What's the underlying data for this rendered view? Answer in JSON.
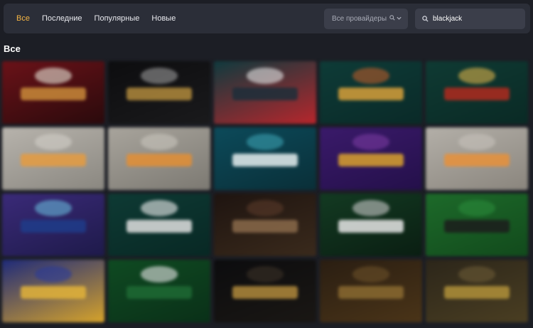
{
  "nav": {
    "tabs": [
      {
        "label": "Все",
        "active": true
      },
      {
        "label": "Последние",
        "active": false
      },
      {
        "label": "Популярные",
        "active": false
      },
      {
        "label": "Новые",
        "active": false
      }
    ]
  },
  "filters": {
    "provider_label": "Все провайдеры",
    "search_value": "blackjack",
    "icons": [
      "search-icon",
      "chevron-down-icon"
    ]
  },
  "section": {
    "title": "Все"
  },
  "colors": {
    "accent": "#f5b544",
    "background": "#1c1e25",
    "panel": "#2b2e38"
  },
  "games": [
    {
      "bg": "#6a1218",
      "bg2": "#2a0a0c",
      "logo": "#c98a3a",
      "deco": "#e8e2d6"
    },
    {
      "bg": "#0d0d0f",
      "bg2": "#1a1a1c",
      "logo": "#b08a3c",
      "deco": "#9a9a9a"
    },
    {
      "bg": "#0f3a3e",
      "bg2": "#b7262c",
      "logo": "#1c2e3a",
      "deco": "#e6e6e6"
    },
    {
      "bg": "#0e3b37",
      "bg2": "#0a2a28",
      "logo": "#d7a03a",
      "deco": "#b95c2a"
    },
    {
      "bg": "#0f3a33",
      "bg2": "#0a2a25",
      "logo": "#b02a1e",
      "deco": "#d8b04a"
    },
    {
      "bg": "#b7b3ac",
      "bg2": "#8a8780",
      "logo": "#e59b3f",
      "deco": "#d2cfc8"
    },
    {
      "bg": "#a8a49c",
      "bg2": "#7c7972",
      "logo": "#e38e34",
      "deco": "#c8c4bc"
    },
    {
      "bg": "#0c4a5a",
      "bg2": "#0a2f38",
      "logo": "#e6eef0",
      "deco": "#3aa0b0"
    },
    {
      "bg": "#3a1a6a",
      "bg2": "#24104a",
      "logo": "#d9a12e",
      "deco": "#7a3aa0"
    },
    {
      "bg": "#b3afa8",
      "bg2": "#8a857d",
      "logo": "#e8903a",
      "deco": "#c7c2ba"
    },
    {
      "bg": "#3a2a78",
      "bg2": "#1e1a4a",
      "logo": "#1e3c8a",
      "deco": "#68b8d8"
    },
    {
      "bg": "#0e3a34",
      "bg2": "#082824",
      "logo": "#e0e0e0",
      "deco": "#f0f0f0"
    },
    {
      "bg": "#1e1410",
      "bg2": "#3a2a1c",
      "logo": "#8a6a4a",
      "deco": "#5a3a2a"
    },
    {
      "bg": "#133a22",
      "bg2": "#0a1e12",
      "logo": "#e6e6e6",
      "deco": "#c8c8c8"
    },
    {
      "bg": "#1d6a2a",
      "bg2": "#124a1c",
      "logo": "#1c1c1c",
      "deco": "#2a8a3a"
    },
    {
      "bg": "#1e2a7a",
      "bg2": "#d6a32a",
      "logo": "#e2b33a",
      "deco": "#2a3a9a"
    },
    {
      "bg": "#0f4a22",
      "bg2": "#0a3018",
      "logo": "#1e6a34",
      "deco": "#e6e6e6"
    },
    {
      "bg": "#0c0c0e",
      "bg2": "#1a1714",
      "logo": "#b08a3c",
      "deco": "#3a3026"
    },
    {
      "bg": "#2a1e12",
      "bg2": "#4a3418",
      "logo": "#8a6a30",
      "deco": "#6a5028"
    },
    {
      "bg": "#2c261a",
      "bg2": "#4a3e22",
      "logo": "#b0903a",
      "deco": "#6a5a36"
    }
  ]
}
